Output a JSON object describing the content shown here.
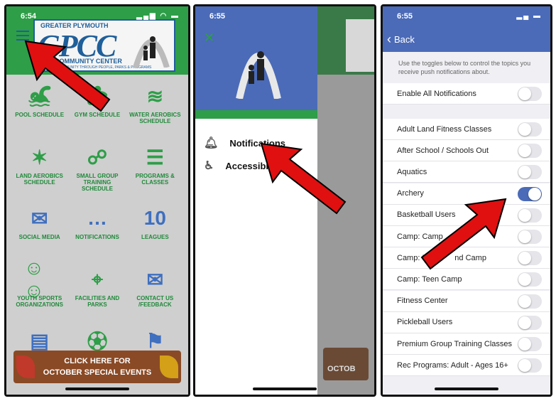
{
  "panel1": {
    "time": "6:54",
    "logo": {
      "line1": "GREATER PLYMOUTH",
      "line2": "GPCC",
      "line3": "COMMUNITY CENTER",
      "tagline": "BUILDING COMMUNITY THROUGH PEOPLE, PARKS & PROGRAMS"
    },
    "tiles": [
      {
        "icon": "swimmer-icon",
        "label": "POOL SCHEDULE"
      },
      {
        "icon": "gym-icon",
        "label": "GYM SCHEDULE"
      },
      {
        "icon": "water-aerobics-icon",
        "label": "WATER AEROBICS SCHEDULE"
      },
      {
        "icon": "land-aerobics-icon",
        "label": "LAND AEROBICS SCHEDULE"
      },
      {
        "icon": "group-training-icon",
        "label": "SMALL GROUP TRAINING SCHEDULE"
      },
      {
        "icon": "clipboard-icon",
        "label": "PROGRAMS & CLASSES"
      },
      {
        "icon": "chat-person-icon",
        "label": "SOCIAL MEDIA"
      },
      {
        "icon": "speech-bubble-icon",
        "label": "NOTIFICATIONS"
      },
      {
        "icon": "jersey-icon",
        "label": "LEAGUES"
      },
      {
        "icon": "people-icon",
        "label": "YOUTH SPORTS ORGANIZATIONS"
      },
      {
        "icon": "map-pin-icon",
        "label": "FACILITIES AND PARKS"
      },
      {
        "icon": "envelope-icon",
        "label": "CONTACT US /FEEDBACK"
      },
      {
        "icon": "id-card-icon",
        "label": ""
      },
      {
        "icon": "soccer-player-icon",
        "label": ""
      },
      {
        "icon": "runner-sign-icon",
        "label": ""
      }
    ],
    "banner": {
      "line1": "CLICK HERE FOR",
      "line2": "OCTOBER SPECIAL EVENTS"
    }
  },
  "panel2": {
    "time": "6:55",
    "menu": [
      {
        "icon": "bell-icon",
        "label": "Notifications"
      },
      {
        "icon": "accessibility-icon",
        "label": "Accessibi"
      }
    ],
    "back_fragment": "OCTOB"
  },
  "panel3": {
    "time": "6:55",
    "back_label": "Back",
    "description": "Use the toggles below to control the topics you receive push notifications about.",
    "enable_all": {
      "label": "Enable All Notifications",
      "on": false
    },
    "topics": [
      {
        "label": "Adult Land Fitness Classes",
        "on": false
      },
      {
        "label": "After School / Schools Out",
        "on": false
      },
      {
        "label": "Aquatics",
        "on": false
      },
      {
        "label": "Archery",
        "on": true
      },
      {
        "label": "Basketball Users",
        "on": false
      },
      {
        "label": "Camp: Camp",
        "on": false
      },
      {
        "label": "Camp: Playg      nd Camp",
        "on": false
      },
      {
        "label": "Camp: Teen Camp",
        "on": false
      },
      {
        "label": "Fitness Center",
        "on": false
      },
      {
        "label": "Pickleball Users",
        "on": false
      },
      {
        "label": "Premium Group Training Classes",
        "on": false
      },
      {
        "label": "Rec Programs: Adult - Ages 16+",
        "on": false
      }
    ]
  },
  "colors": {
    "green": "#2e9e48",
    "blue": "#4b6bb8",
    "arrow_red": "#e01010",
    "label_green": "#1f8a3a"
  }
}
